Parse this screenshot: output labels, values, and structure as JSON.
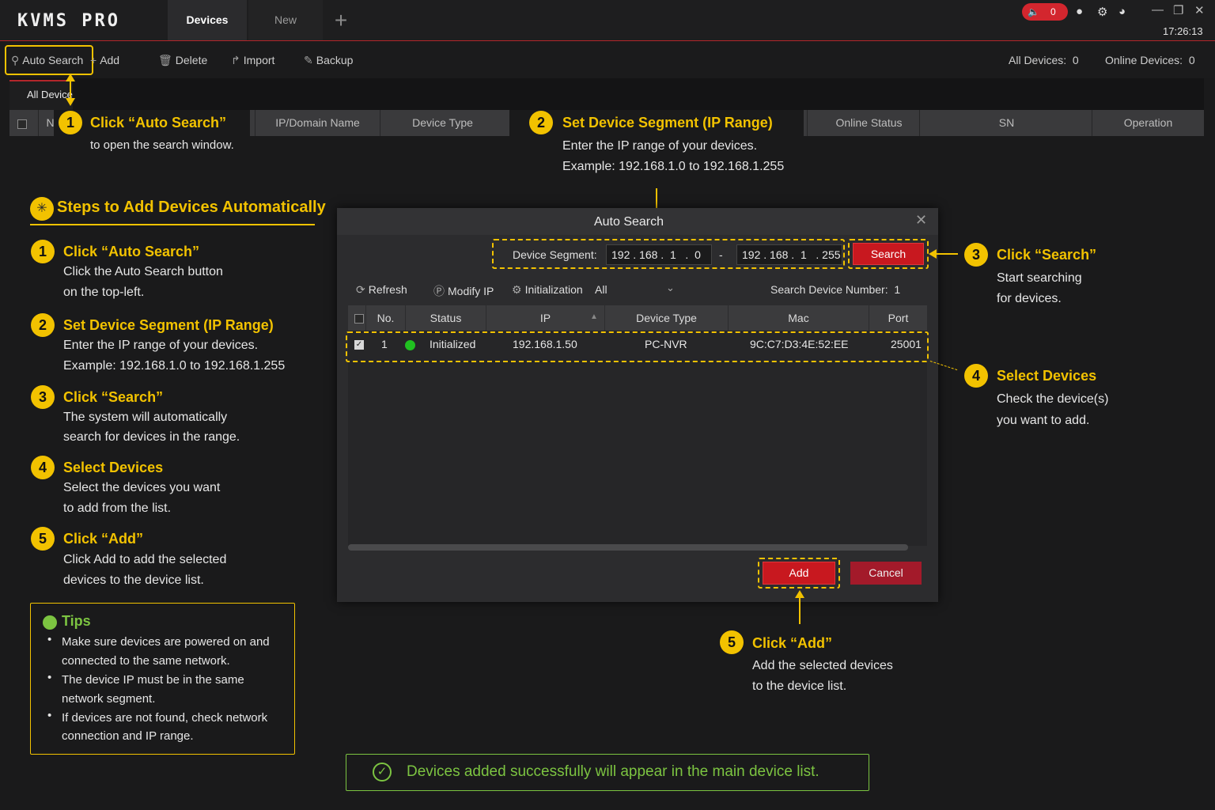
{
  "app": {
    "logo": "KVMS PRO",
    "clock": "17:26:13",
    "alarm_count": "0"
  },
  "tabs": [
    {
      "label": "Devices"
    },
    {
      "label": "New"
    }
  ],
  "toolbar": {
    "auto_search": "Auto Search",
    "add": "Add",
    "delete": "Delete",
    "import": "Import",
    "backup": "Backup",
    "all_devices_label": "All Devices:",
    "all_devices_count": "0",
    "online_devices_label": "Online Devices:",
    "online_devices_count": "0"
  },
  "subtab": {
    "all_devices": "All Device"
  },
  "main_table": {
    "columns": [
      "N",
      "IP/Domain Name",
      "Device Type",
      "Online Status",
      "SN",
      "Operation"
    ]
  },
  "callouts": {
    "c1": {
      "num": "1",
      "title": "Click “Auto Search”",
      "text": "to open the search window."
    },
    "c2": {
      "num": "2",
      "title": "Set Device Segment (IP Range)",
      "line1": "Enter the IP range of your devices.",
      "line2": "Example: 192.168.1.0 to 192.168.1.255"
    },
    "c3": {
      "num": "3",
      "title": "Click “Search”",
      "line1": "Start searching",
      "line2": "for devices."
    },
    "c4": {
      "num": "4",
      "title": "Select Devices",
      "line1": "Check the device(s)",
      "line2": "you want to add."
    },
    "c5": {
      "num": "5",
      "title": "Click “Add”",
      "line1": "Add the selected devices",
      "line2": "to the device list."
    }
  },
  "steps": {
    "title": "Steps to Add Devices Automatically",
    "items": [
      {
        "num": "1",
        "title": "Click “Auto Search”",
        "line1": "Click the Auto Search button",
        "line2": "on the top-left."
      },
      {
        "num": "2",
        "title": "Set Device Segment (IP Range)",
        "line1": "Enter the IP range of your devices.",
        "line2": "Example: 192.168.1.0 to 192.168.1.255"
      },
      {
        "num": "3",
        "title": "Click “Search”",
        "line1": "The system will automatically",
        "line2": "search for devices in the range."
      },
      {
        "num": "4",
        "title": "Select Devices",
        "line1": "Select the devices you want",
        "line2": "to add from the list."
      },
      {
        "num": "5",
        "title": "Click “Add”",
        "line1": "Click Add to add the selected",
        "line2": "devices to the device list."
      }
    ]
  },
  "tips": {
    "title": "Tips",
    "lines": [
      "Make sure devices are powered on and",
      "connected to the same network.",
      "The device IP must be in the same",
      "network segment.",
      "If devices are not found, check network",
      "connection and IP range."
    ]
  },
  "dialog": {
    "title": "Auto Search",
    "segment_label": "Device Segment:",
    "ip_start": "192 . 168 .  1   .  0",
    "ip_separator": "-",
    "ip_end": "192 . 168 .  1   . 255",
    "search_button": "Search",
    "refresh": "Refresh",
    "modify_ip": "Modify IP",
    "initialization": "Initialization",
    "filter_value": "All",
    "search_count_label": "Search Device Number:",
    "search_count": "1",
    "columns": [
      "No.",
      "Status",
      "IP",
      "Device Type",
      "Mac",
      "Port"
    ],
    "rows": [
      {
        "no": "1",
        "status": "Initialized",
        "ip": "192.168.1.50",
        "device_type": "PC-NVR",
        "mac": "9C:C7:D3:4E:52:EE",
        "port": "25001"
      }
    ],
    "add_button": "Add",
    "cancel_button": "Cancel"
  },
  "success_message": "Devices added successfully will appear in the main device list.",
  "colors": {
    "accent_yellow": "#f2c200",
    "brand_red": "#c8181f",
    "success_green": "#7cc441"
  }
}
